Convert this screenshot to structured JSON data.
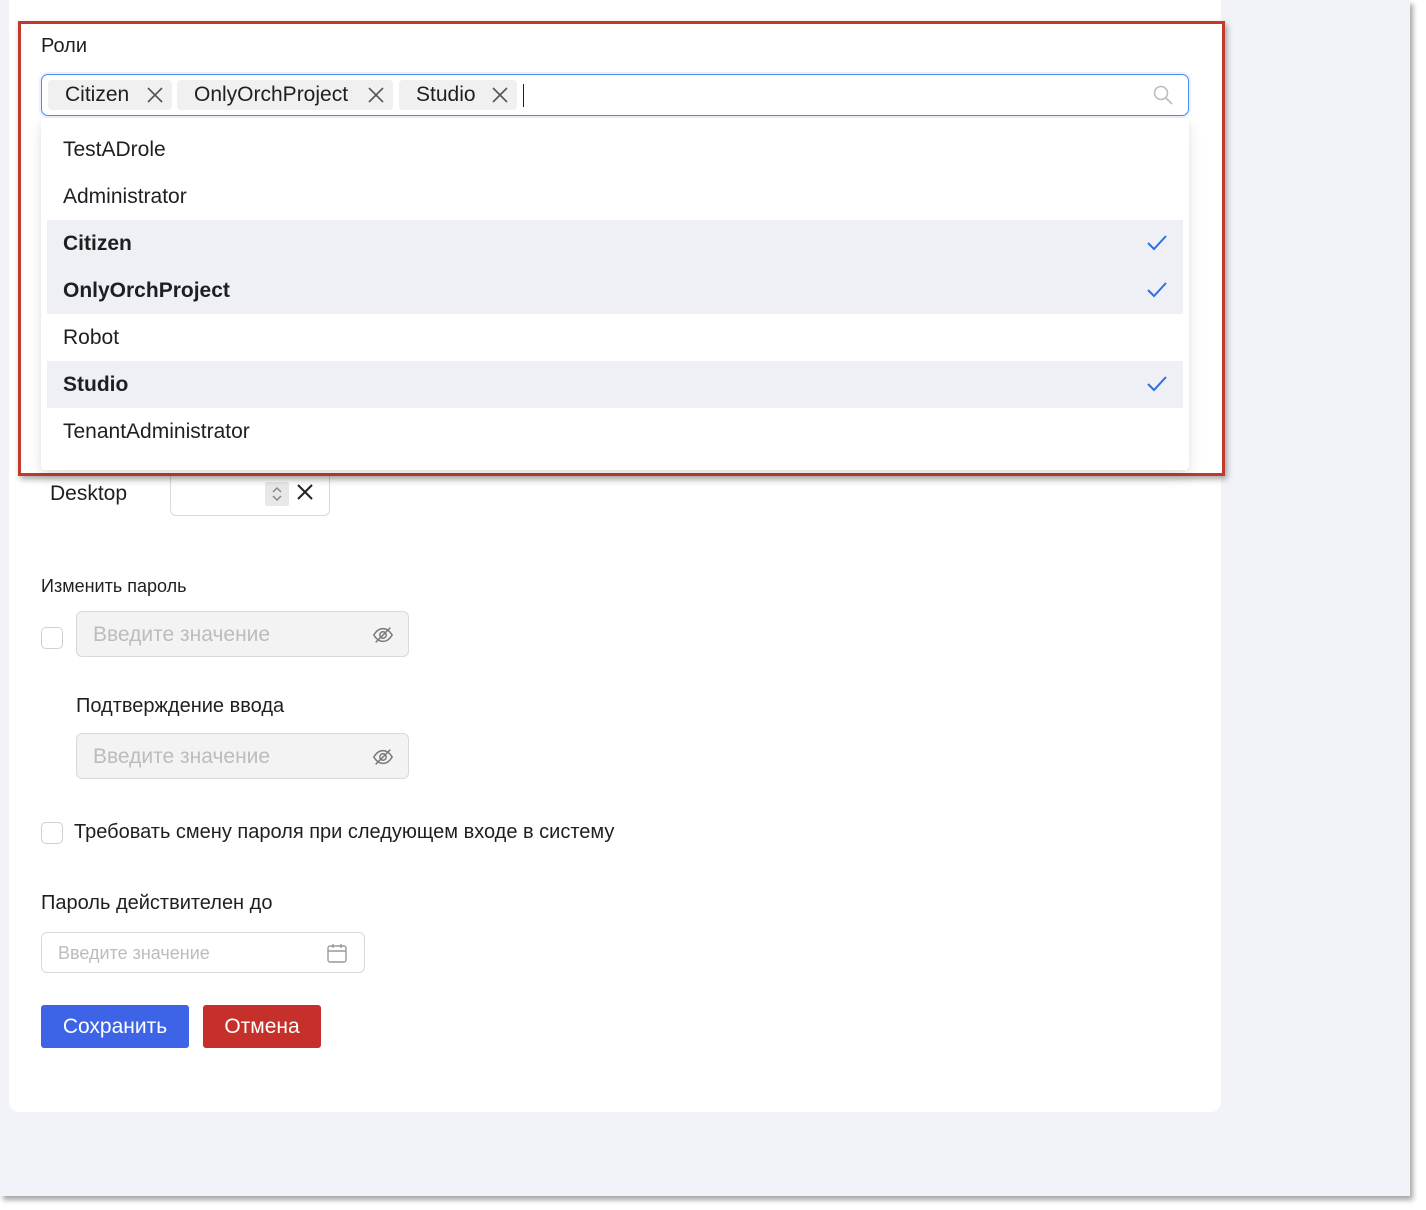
{
  "roles": {
    "label": "Роли",
    "selected_tags": [
      "Citizen",
      "OnlyOrchProject",
      "Studio"
    ],
    "options": [
      {
        "label": "TestADrole",
        "selected": false
      },
      {
        "label": "Administrator",
        "selected": false
      },
      {
        "label": "Citizen",
        "selected": true
      },
      {
        "label": "OnlyOrchProject",
        "selected": true
      },
      {
        "label": "Robot",
        "selected": false
      },
      {
        "label": "Studio",
        "selected": true
      },
      {
        "label": "TenantAdministrator",
        "selected": false
      }
    ]
  },
  "desktop": {
    "label": "Desktop",
    "value": ""
  },
  "password": {
    "change_label": "Изменить пароль",
    "placeholder": "Введите значение",
    "confirm_label": "Подтверждение ввода",
    "confirm_placeholder": "Введите значение",
    "require_change_label": "Требовать смену пароля при следующем входе в систему",
    "valid_until_label": "Пароль действителен до",
    "valid_until_placeholder": "Введите значение"
  },
  "buttons": {
    "save": "Сохранить",
    "cancel": "Отмена"
  },
  "colors": {
    "accent": "#3d63e6",
    "danger": "#c5302a",
    "highlight": "#c0392b",
    "check": "#2f6fe4"
  }
}
